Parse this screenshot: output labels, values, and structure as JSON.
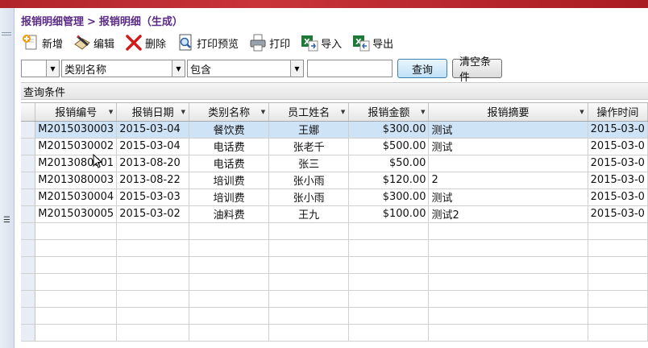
{
  "breadcrumb": {
    "parent": "报销明细管理",
    "separator": ">",
    "current": "报销明细（生成）"
  },
  "toolbar": {
    "new_label": "新增",
    "edit_label": "编辑",
    "delete_label": "删除",
    "preview_label": "打印预览",
    "print_label": "打印",
    "import_label": "导入",
    "export_label": "导出"
  },
  "filter": {
    "field_selected": "类别名称",
    "operator_selected": "包含",
    "value": "",
    "search_label": "查询",
    "clear_label": "清空条件"
  },
  "section": {
    "title": "查询条件"
  },
  "grid": {
    "columns": [
      "报销编号",
      "报销日期",
      "类别名称",
      "员工姓名",
      "报销金额",
      "报销摘要",
      "操作时间"
    ],
    "rows": [
      [
        "M2015030003",
        "2015-03-04",
        "餐饮费",
        "王娜",
        "$300.00",
        "测试",
        "2015-03-0"
      ],
      [
        "M2015030002",
        "2015-03-04",
        "电话费",
        "张老千",
        "$500.00",
        "测试",
        "2015-03-0"
      ],
      [
        "M2013080001",
        "2013-08-20",
        "电话费",
        "张三",
        "$50.00",
        "",
        "2015-03-0"
      ],
      [
        "M2013080003",
        "2013-08-22",
        "培训费",
        "张小雨",
        "$120.00",
        "2",
        "2015-03-0"
      ],
      [
        "M2015030004",
        "2015-03-03",
        "培训费",
        "张小雨",
        "$300.00",
        "测试",
        "2015-03-0"
      ],
      [
        "M2015030005",
        "2015-03-02",
        "油料费",
        "王九",
        "$100.00",
        "测试2",
        "2015-03-0"
      ]
    ],
    "selected_row": 0
  },
  "colors": {
    "accent": "#5b2a86",
    "selection": "#cfe3f7",
    "topbar": "#b0242a"
  }
}
